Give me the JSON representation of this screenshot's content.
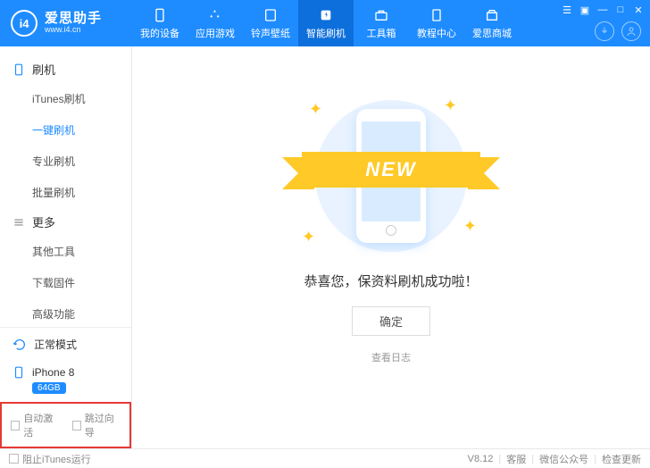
{
  "app": {
    "logo_initials": "i4",
    "title": "爱思助手",
    "subtitle": "www.i4.cn"
  },
  "nav": [
    {
      "label": "我的设备",
      "icon": "phone"
    },
    {
      "label": "应用游戏",
      "icon": "app"
    },
    {
      "label": "铃声壁纸",
      "icon": "music"
    },
    {
      "label": "智能刷机",
      "icon": "flash",
      "active": true
    },
    {
      "label": "工具箱",
      "icon": "toolbox"
    },
    {
      "label": "教程中心",
      "icon": "book"
    },
    {
      "label": "爱思商城",
      "icon": "store"
    }
  ],
  "sidebar": {
    "section1": {
      "title": "刷机",
      "items": [
        "iTunes刷机",
        "一键刷机",
        "专业刷机",
        "批量刷机"
      ],
      "active_index": 1
    },
    "section2": {
      "title": "更多",
      "items": [
        "其他工具",
        "下载固件",
        "高级功能"
      ]
    },
    "status": "正常模式",
    "device": {
      "name": "iPhone 8",
      "storage": "64GB"
    },
    "checkboxes": [
      "自动激活",
      "跳过向导"
    ]
  },
  "main": {
    "ribbon": "NEW",
    "success_message": "恭喜您，保资料刷机成功啦！",
    "ok_button": "确定",
    "view_log": "查看日志"
  },
  "footer": {
    "block_itunes": "阻止iTunes运行",
    "version": "V8.12",
    "links": [
      "客服",
      "微信公众号",
      "检查更新"
    ]
  }
}
